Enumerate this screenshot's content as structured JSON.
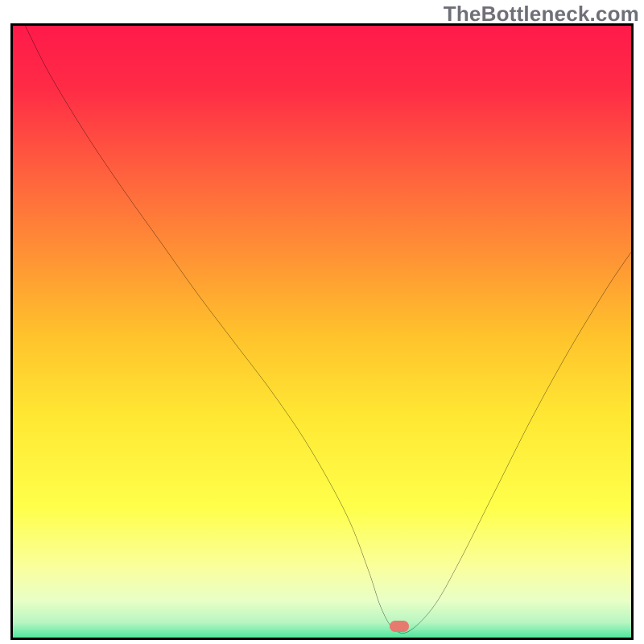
{
  "watermark": "TheBottleneck.com",
  "colors": {
    "border": "#000000",
    "curve": "#000000",
    "marker": "#e77a6f",
    "gradient_stops": [
      {
        "offset": 0.0,
        "color": "#ff1a4a"
      },
      {
        "offset": 0.1,
        "color": "#ff2b46"
      },
      {
        "offset": 0.22,
        "color": "#ff5a3f"
      },
      {
        "offset": 0.35,
        "color": "#ff8a36"
      },
      {
        "offset": 0.5,
        "color": "#ffc22c"
      },
      {
        "offset": 0.63,
        "color": "#ffe733"
      },
      {
        "offset": 0.78,
        "color": "#ffff4a"
      },
      {
        "offset": 0.88,
        "color": "#f9ffa0"
      },
      {
        "offset": 0.93,
        "color": "#e8ffc6"
      },
      {
        "offset": 0.965,
        "color": "#b8f6c2"
      },
      {
        "offset": 0.985,
        "color": "#63e9a4"
      },
      {
        "offset": 1.0,
        "color": "#2fe288"
      }
    ]
  },
  "chart_data": {
    "type": "line",
    "title": "",
    "xlabel": "",
    "ylabel": "",
    "xlim": [
      0,
      100
    ],
    "ylim": [
      0,
      100
    ],
    "grid": false,
    "legend": false,
    "series": [
      {
        "name": "curve",
        "x": [
          2,
          6,
          12,
          18,
          24,
          30,
          36,
          42,
          48,
          54,
          57.5,
          59.5,
          61.5,
          64,
          68,
          72,
          78,
          84,
          90,
          96,
          100
        ],
        "y": [
          100,
          92,
          82,
          73,
          64.5,
          56,
          48,
          40,
          31,
          20,
          11,
          5,
          1.5,
          1,
          5,
          12,
          24,
          36,
          47,
          57,
          63
        ]
      }
    ],
    "annotations": [
      {
        "type": "marker",
        "shape": "pill",
        "x": 62.5,
        "y": 1.8,
        "color": "#e77a6f"
      }
    ]
  }
}
